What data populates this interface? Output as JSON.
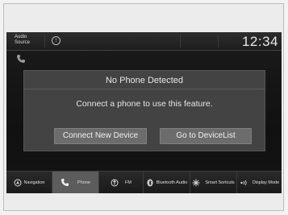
{
  "status_bar": {
    "audio_source_label": "Audio Source",
    "clock": "12:34"
  },
  "dialog": {
    "title": "No Phone Detected",
    "message": "Connect a phone to use this feature.",
    "connect_button_label": "Connect New Device",
    "device_list_button_label": "Go to DeviceList"
  },
  "navbar": {
    "items": [
      {
        "label": "Navigation",
        "icon": "navigation-icon",
        "active": false
      },
      {
        "label": "Phone",
        "icon": "phone-icon",
        "active": true
      },
      {
        "label": "FM",
        "icon": "antenna-icon",
        "active": false
      },
      {
        "label": "Bluetooth Audio",
        "icon": "bluetooth-icon",
        "active": false
      },
      {
        "label": "Smart Sortcuts",
        "icon": "smart-shortcuts-icon",
        "active": false
      },
      {
        "label": "Display Mode",
        "icon": "display-mode-icon",
        "active": false
      }
    ]
  },
  "colors": {
    "screen_bg": "#141414",
    "dialog_bg": "#434343",
    "button_bg": "#6c6c6c",
    "active_tab_bg": "#5c5c5c",
    "text": "#e6e6e6"
  }
}
